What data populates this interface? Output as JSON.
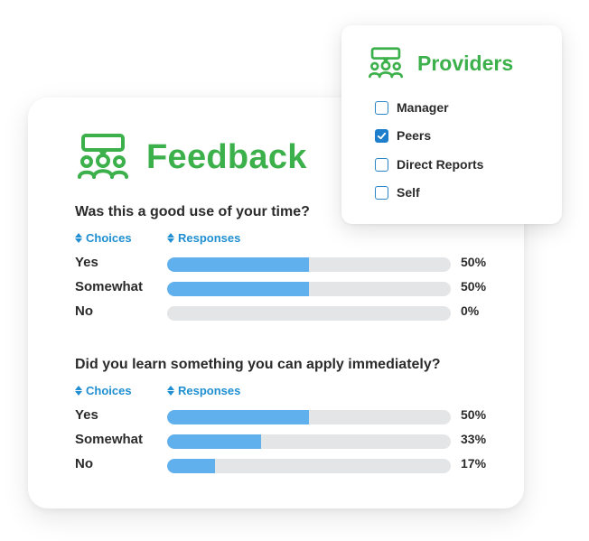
{
  "feedback": {
    "title": "Feedback",
    "icon": "feedback-group-icon",
    "accent_color": "#3cb04a",
    "bar_color": "#5fb0ec",
    "track_color": "#e4e5e7",
    "questions": [
      {
        "text": "Was this a good use of your time?",
        "col_choices": "Choices",
        "col_responses": "Responses",
        "rows": [
          {
            "label": "Yes",
            "value": 50,
            "pct": "50%"
          },
          {
            "label": "Somewhat",
            "value": 50,
            "pct": "50%"
          },
          {
            "label": "No",
            "value": 0,
            "pct": "0%"
          }
        ]
      },
      {
        "text": "Did you learn something you can apply immediately?",
        "col_choices": "Choices",
        "col_responses": "Responses",
        "rows": [
          {
            "label": "Yes",
            "value": 50,
            "pct": "50%"
          },
          {
            "label": "Somewhat",
            "value": 33,
            "pct": "33%"
          },
          {
            "label": "No",
            "value": 17,
            "pct": "17%"
          }
        ]
      }
    ]
  },
  "providers": {
    "title": "Providers",
    "icon": "providers-group-icon",
    "options": [
      {
        "label": "Manager",
        "checked": false
      },
      {
        "label": "Peers",
        "checked": true
      },
      {
        "label": "Direct Reports",
        "checked": false
      },
      {
        "label": "Self",
        "checked": false
      }
    ]
  }
}
